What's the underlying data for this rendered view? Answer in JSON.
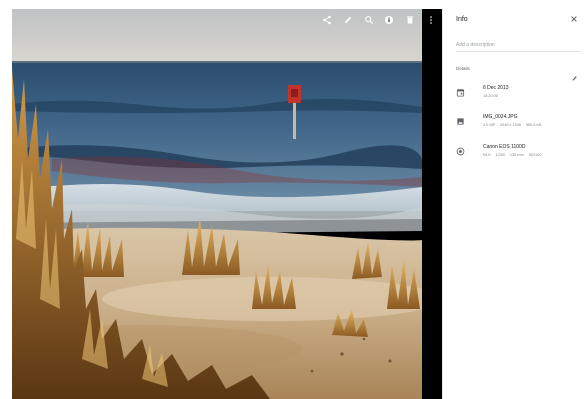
{
  "viewer": {
    "toolbar": [
      {
        "icon": "share-icon"
      },
      {
        "icon": "edit-icon"
      },
      {
        "icon": "zoom-icon"
      },
      {
        "icon": "info-icon"
      },
      {
        "icon": "delete-icon"
      },
      {
        "icon": "more-icon"
      }
    ]
  },
  "info": {
    "title": "Info",
    "description_placeholder": "Add a description",
    "details_label": "Details",
    "date": {
      "icon": "calendar-icon",
      "primary": "6 Dec 2013",
      "secondary": [
        "15:20:06"
      ]
    },
    "file": {
      "icon": "image-icon",
      "primary": "IMG_0024.JPG",
      "secondary": [
        "3.0 MP",
        "2048 x 1536",
        "590.6 KB"
      ]
    },
    "camera": {
      "icon": "aperture-icon",
      "primary": "Canon EOS 1100D",
      "secondary": [
        "f/5.6",
        "1/250",
        "135 mm",
        "ISO100"
      ]
    }
  },
  "colors": {
    "panel_bg": "#ffffff",
    "viewer_bg": "#000000",
    "text_primary": "#202124",
    "text_secondary": "#80868b"
  }
}
